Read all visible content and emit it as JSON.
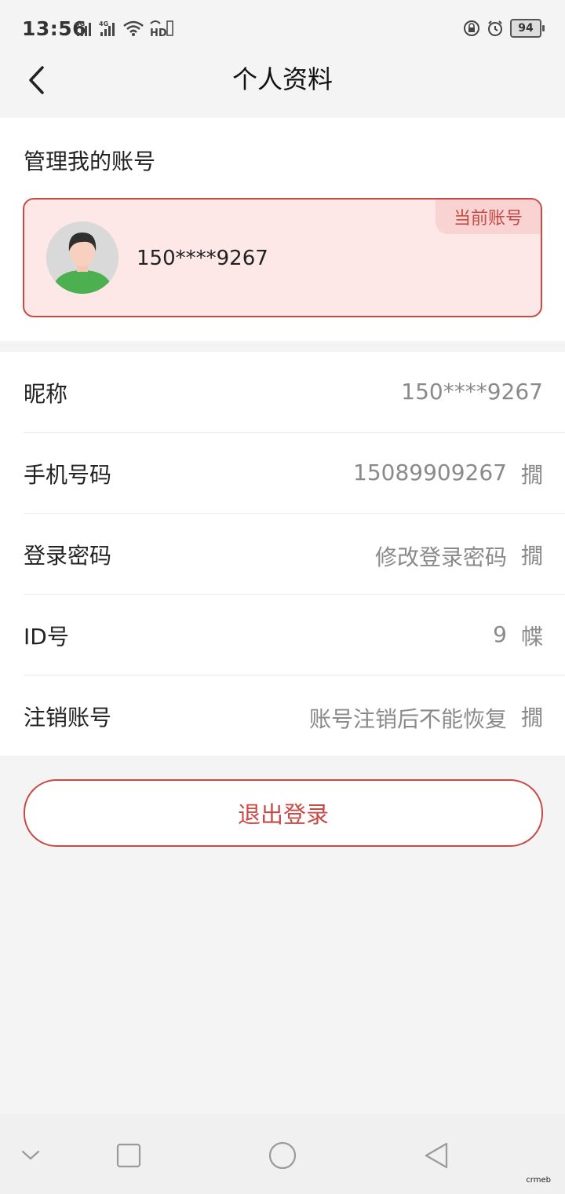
{
  "status_bar": {
    "time": "13:56",
    "battery": "94"
  },
  "nav": {
    "title": "个人资料"
  },
  "account_section": {
    "title": "管理我的账号",
    "badge": "当前账号",
    "account_name": "150****9267"
  },
  "info_rows": [
    {
      "label": "昵称",
      "value": "150****9267",
      "arrow": ""
    },
    {
      "label": "手机号码",
      "value": "15089909267",
      "arrow": "撊"
    },
    {
      "label": "登录密码",
      "value": "修改登录密码",
      "arrow": "撊"
    },
    {
      "label": "ID号",
      "value": "9",
      "arrow": "幉"
    },
    {
      "label": "注销账号",
      "value": "账号注销后不能恢复",
      "arrow": "撊"
    }
  ],
  "logout_label": "退出登录",
  "watermark": "crmeb",
  "colors": {
    "accent": "#c94a45",
    "card_bg": "#fde7e7",
    "page_bg": "#f4f4f4"
  }
}
